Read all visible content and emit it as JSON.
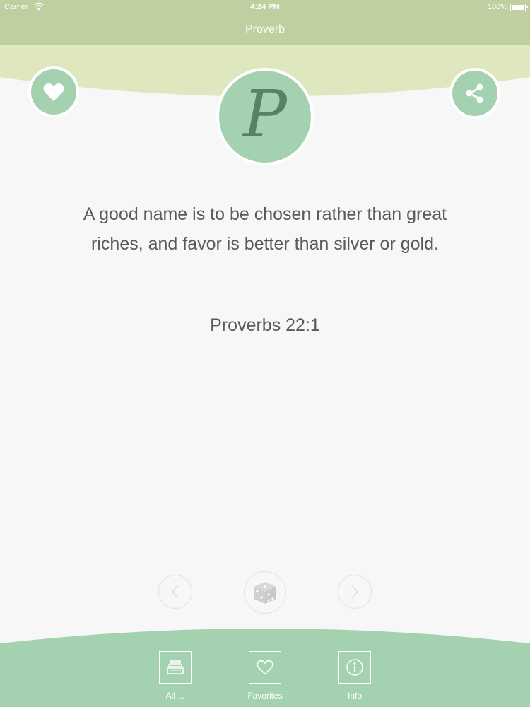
{
  "status_bar": {
    "carrier": "Carrier",
    "time": "4:24 PM",
    "battery": "100%"
  },
  "nav": {
    "title": "Proverb"
  },
  "logo": {
    "letter": "P"
  },
  "quote": {
    "text": "A good name is to be chosen rather than great riches, and favor is better than silver or gold.",
    "reference": "Proverbs 22:1"
  },
  "controls": {
    "prev_icon": "chevron-left-icon",
    "random_icon": "dice-icon",
    "next_icon": "chevron-right-icon"
  },
  "tabs": [
    {
      "label": "All ...",
      "icon": "list-icon"
    },
    {
      "label": "Favorites",
      "icon": "heart-icon"
    },
    {
      "label": "Info",
      "icon": "info-icon"
    }
  ],
  "colors": {
    "header": "#bfcf9f",
    "accent": "#a4d2b0",
    "accent_dark": "#5a8066",
    "hero_band": "#dfe7be",
    "background": "#f7f7f7"
  }
}
